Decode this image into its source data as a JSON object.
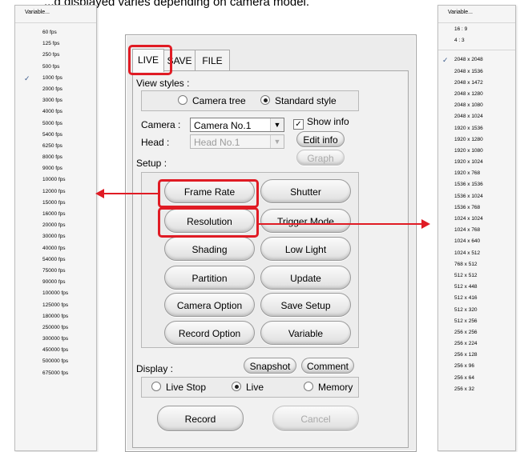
{
  "caption_fragment": "...d displayed varies depending on camera model.",
  "fps_menu": {
    "header": "Variable...",
    "items": [
      "60 fps",
      "125 fps",
      "250 fps",
      "500 fps",
      "1000 fps",
      "2000 fps",
      "3000 fps",
      "4000 fps",
      "5000 fps",
      "5400 fps",
      "6250 fps",
      "8000 fps",
      "9000 fps",
      "10000 fps",
      "12000 fps",
      "15000 fps",
      "16000 fps",
      "20000 fps",
      "30000 fps",
      "40000 fps",
      "54000 fps",
      "75000 fps",
      "90000 fps",
      "100000 fps",
      "125000 fps",
      "180000 fps",
      "250000 fps",
      "300000 fps",
      "450000 fps",
      "500000 fps",
      "675000 fps"
    ],
    "checked_index": 4
  },
  "res_menu": {
    "header": "Variable...",
    "aspect_items": [
      "16 : 9",
      "4 : 3"
    ],
    "items": [
      "2048 x 2048",
      "2048 x 1536",
      "2048 x 1472",
      "2048 x 1280",
      "2048 x 1080",
      "2048 x 1024",
      "1920 x 1536",
      "1920 x 1280",
      "1920 x 1080",
      "1920 x 1024",
      "1920 x 768",
      "1536 x 1536",
      "1536 x 1024",
      "1536 x 768",
      "1024 x 1024",
      "1024 x 768",
      "1024 x 640",
      "1024 x 512",
      "768 x 512",
      "512 x 512",
      "512 x 448",
      "512 x 416",
      "512 x 320",
      "512 x 256",
      "256 x 256",
      "256 x 224",
      "256 x 128",
      "256 x 96",
      "256 x 64",
      "256 x 32"
    ],
    "checked_index": 0
  },
  "panel": {
    "tabs": [
      "LIVE",
      "SAVE",
      "FILE"
    ],
    "view_styles_label": "View styles :",
    "radio_camera_tree": "Camera tree",
    "radio_standard_style": "Standard style",
    "camera_label": "Camera :",
    "camera_value": "Camera No.1",
    "head_label": "Head :",
    "head_value": "Head No.1",
    "show_info_label": "Show info",
    "edit_info_label": "Edit info",
    "graph_label": "Graph",
    "setup_label": "Setup :",
    "buttons": {
      "frame_rate": "Frame Rate",
      "shutter": "Shutter",
      "resolution": "Resolution",
      "trigger_mode": "Trigger Mode",
      "shading": "Shading",
      "low_light": "Low Light",
      "partition": "Partition",
      "update": "Update",
      "camera_option": "Camera Option",
      "save_setup": "Save Setup",
      "record_option": "Record Option",
      "variable": "Variable"
    },
    "snapshot_label": "Snapshot",
    "comment_label": "Comment",
    "display_label": "Display :",
    "radio_live_stop": "Live Stop",
    "radio_live": "Live",
    "radio_memory": "Memory",
    "record_label": "Record",
    "cancel_label": "Cancel"
  },
  "colors": {
    "highlight": "#e01b24",
    "panel_bg": "#ececec"
  }
}
